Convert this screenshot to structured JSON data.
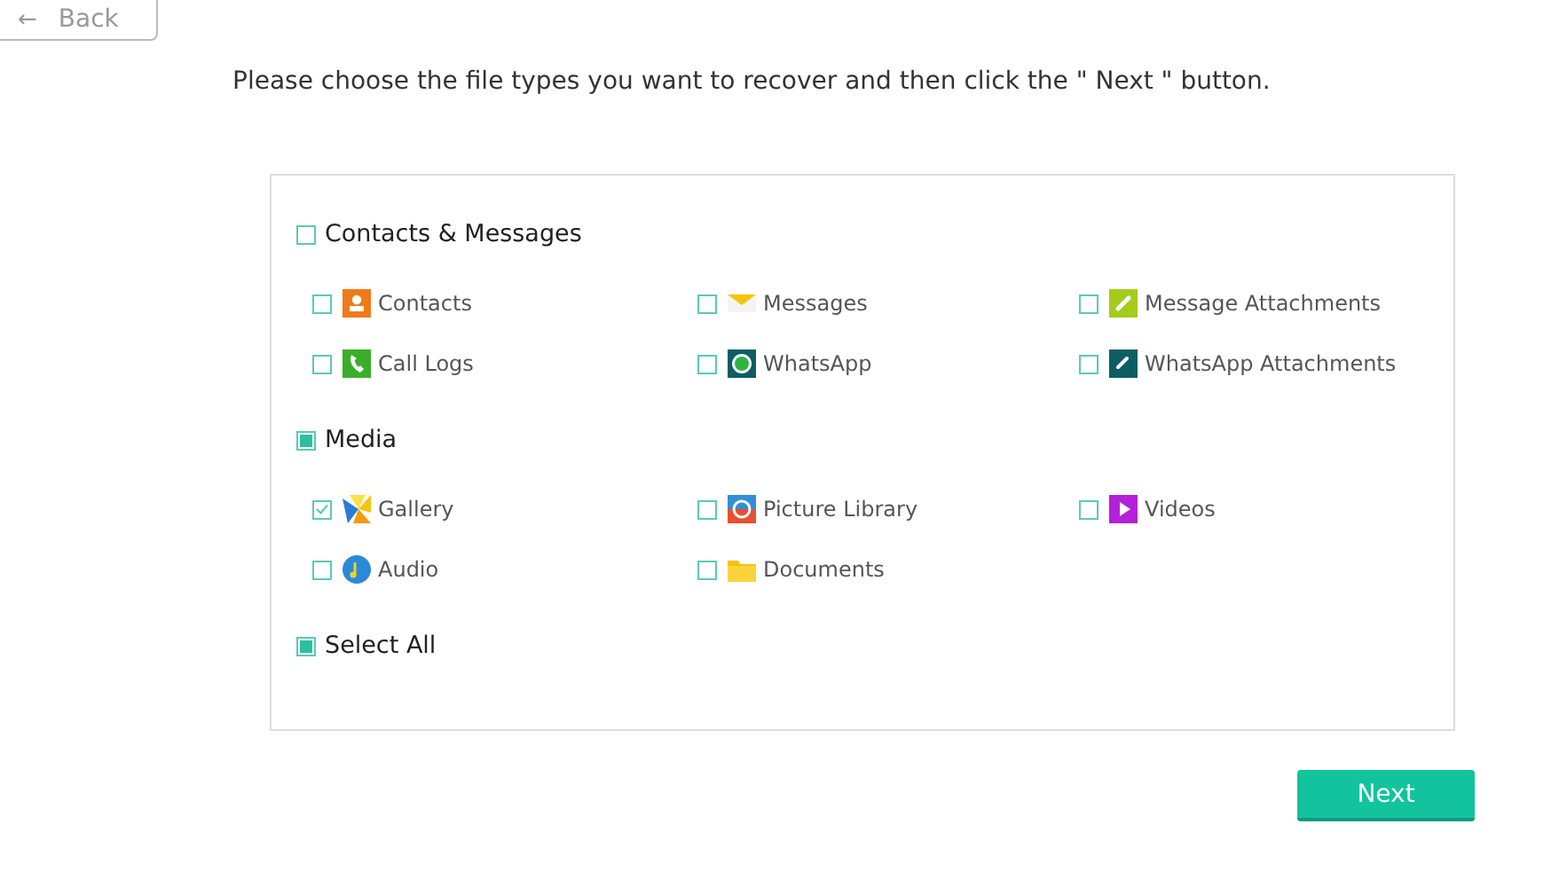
{
  "back_button": {
    "arrow": "←",
    "label": "Back"
  },
  "instruction": "Please choose the file types you want to recover and then click the \" Next \" button.",
  "groups": [
    {
      "label": "Contacts & Messages",
      "checked": false,
      "partial": false,
      "items": [
        {
          "label": "Contacts",
          "kind": "contacts",
          "checked": false
        },
        {
          "label": "Messages",
          "kind": "messages",
          "checked": false
        },
        {
          "label": "Message Attachments",
          "kind": "attachments",
          "checked": false
        },
        {
          "label": "Call Logs",
          "kind": "calls",
          "checked": false
        },
        {
          "label": "WhatsApp",
          "kind": "whatsapp",
          "checked": false
        },
        {
          "label": "WhatsApp Attachments",
          "kind": "clip",
          "checked": false
        }
      ]
    },
    {
      "label": "Media",
      "checked": false,
      "partial": true,
      "items": [
        {
          "label": "Gallery",
          "kind": "gallery",
          "checked": true
        },
        {
          "label": "Picture Library",
          "kind": "pictures",
          "checked": false
        },
        {
          "label": "Videos",
          "kind": "videos",
          "checked": false
        },
        {
          "label": "Audio",
          "kind": "audio",
          "checked": false
        },
        {
          "label": "Documents",
          "kind": "documents",
          "checked": false
        }
      ]
    }
  ],
  "select_all": {
    "label": "Select All",
    "checked": false,
    "partial": true
  },
  "next_button": "Next"
}
